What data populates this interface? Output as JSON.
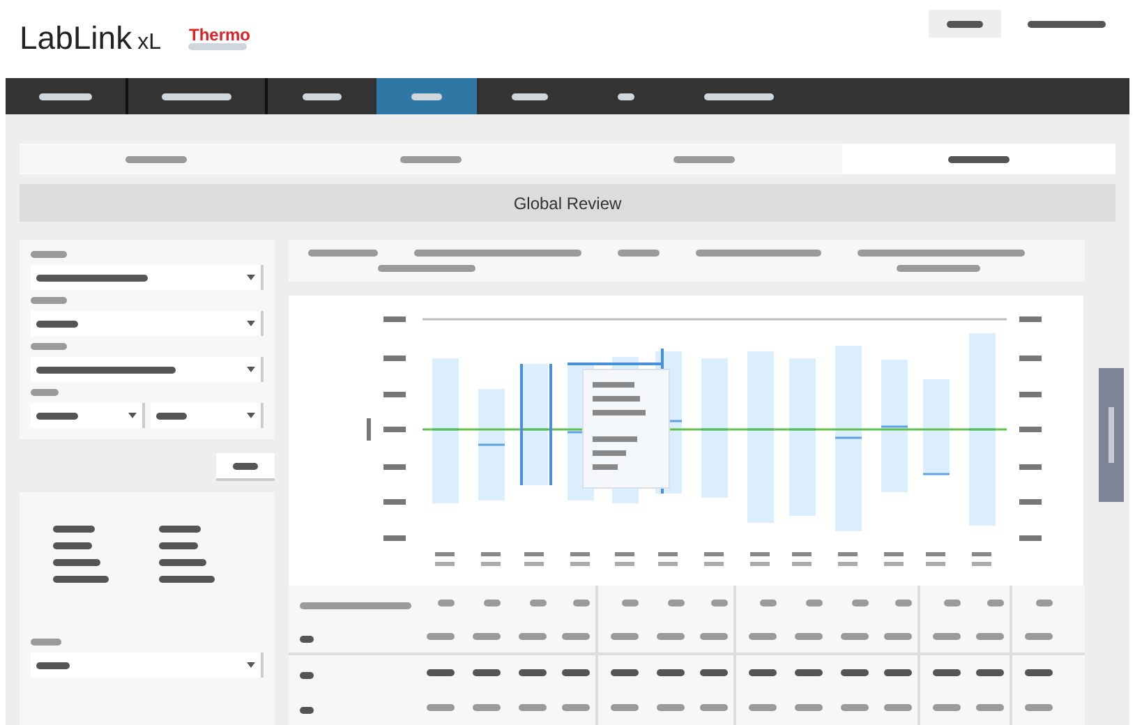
{
  "header": {
    "product": "LabLink",
    "product_suffix": "xL",
    "brand": "Thermo"
  },
  "nav": [
    {
      "selected": false
    },
    {
      "selected": false
    },
    {
      "selected": false
    },
    {
      "selected": true
    },
    {
      "selected": false
    },
    {
      "selected": false
    },
    {
      "selected": false
    }
  ],
  "subtabs": [
    {
      "selected": false
    },
    {
      "selected": false
    },
    {
      "selected": false
    },
    {
      "selected": true
    }
  ],
  "section_title": "Global Review"
}
